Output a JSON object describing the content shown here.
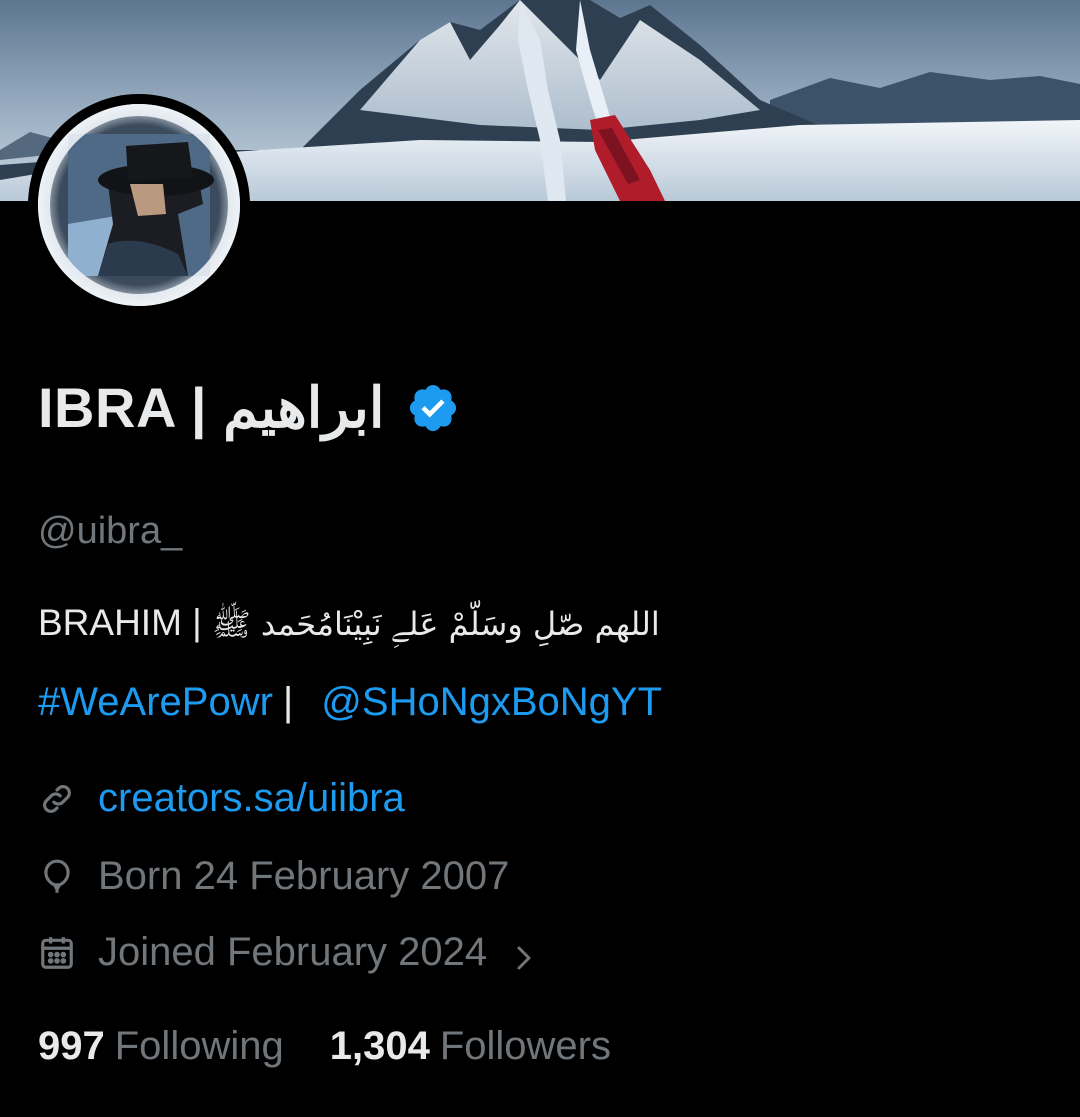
{
  "profile": {
    "display_name": "IBRA | ابراهيم",
    "handle": "@uibra_",
    "verified_icon": "verified-badge-icon",
    "bio_line1_latin": "BRAHIM |",
    "bio_line1_arabic": "اللهم صّلِ وسَلّمْ عَلےِ نَبِيْنَامُحَمد ﷺ",
    "hashtag": "#WeArePowr",
    "separator": "|",
    "mention": "@SHoNgxBoNgYT",
    "website": "creators.sa/uiibra",
    "born": "Born 24 February 2007",
    "joined": "Joined February 2024",
    "following_count": "997",
    "following_label": "Following",
    "followers_count": "1,304",
    "followers_label": "Followers"
  },
  "icons": {
    "link": "link-icon",
    "birthday": "balloon-icon",
    "joined": "calendar-icon",
    "chevron": "chevron-right-icon"
  },
  "colors": {
    "background": "#000000",
    "text": "#e7e9ea",
    "secondary": "#71767b",
    "accent": "#1d9bf0"
  }
}
